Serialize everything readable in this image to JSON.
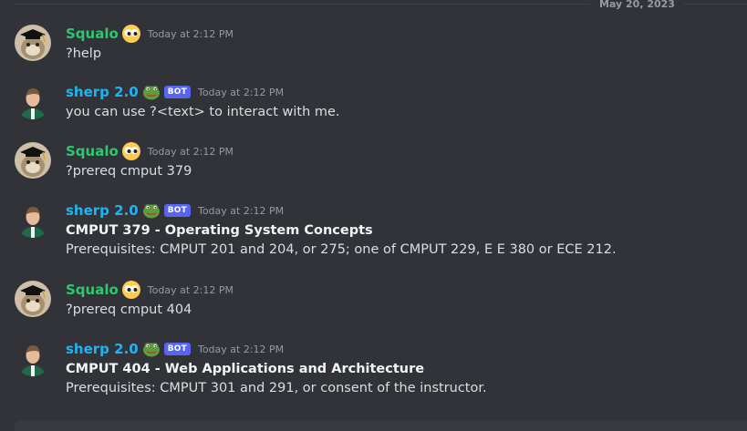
{
  "date_divider": "May 20, 2023",
  "colors": {
    "background": "#313338",
    "squalo_name": "#2dc770",
    "sherp_name": "#1fb4f0",
    "bot_tag": "#5865f2"
  },
  "messages": [
    {
      "author": "Squalo",
      "author_icon": "googly-eyes-emoji",
      "timestamp": "Today at 2:12 PM",
      "lines": [
        "?help"
      ]
    },
    {
      "author": "sherp 2.0",
      "author_icon": "frog-emoji",
      "bot_tag": "BOT",
      "timestamp": "Today at 2:12 PM",
      "lines": [
        "you can use ?<text> to interact with me."
      ]
    },
    {
      "author": "Squalo",
      "author_icon": "googly-eyes-emoji",
      "timestamp": "Today at 2:12 PM",
      "lines": [
        "?prereq cmput 379"
      ]
    },
    {
      "author": "sherp 2.0",
      "author_icon": "frog-emoji",
      "bot_tag": "BOT",
      "timestamp": "Today at 2:12 PM",
      "title": "CMPUT 379 - Operating System Concepts",
      "lines": [
        "Prerequisites: CMPUT 201 and 204, or 275; one of CMPUT 229, E E 380 or ECE 212."
      ]
    },
    {
      "author": "Squalo",
      "author_icon": "googly-eyes-emoji",
      "timestamp": "Today at 2:12 PM",
      "lines": [
        "?prereq cmput 404"
      ]
    },
    {
      "author": "sherp 2.0",
      "author_icon": "frog-emoji",
      "bot_tag": "BOT",
      "timestamp": "Today at 2:12 PM",
      "title": "CMPUT 404 - Web Applications and Architecture",
      "lines": [
        "Prerequisites: CMPUT 301 and 291, or consent of the instructor."
      ]
    }
  ]
}
